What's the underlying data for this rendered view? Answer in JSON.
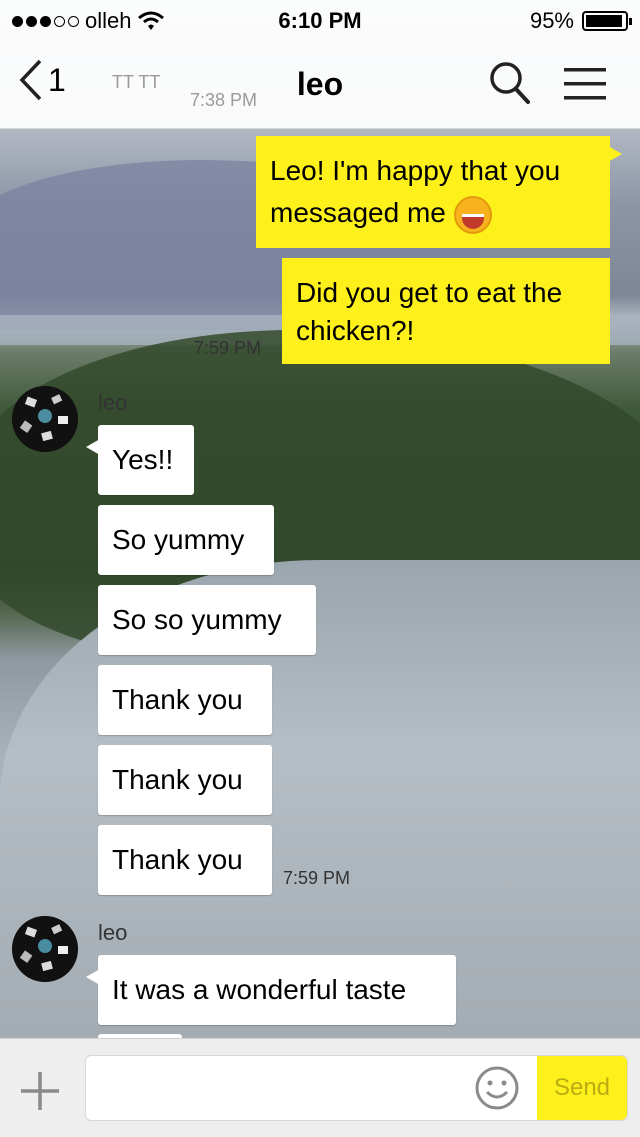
{
  "status": {
    "carrier": "olleh",
    "time": "6:10 PM",
    "battery": "95%",
    "battery_level": 0.95
  },
  "nav": {
    "back_count": "1",
    "title": "leo",
    "ghost_time": "7:38 PM",
    "ghost_text": "TT TT"
  },
  "messages": {
    "m1a": "Leo! I'm happy that you",
    "m1b": "messaged me",
    "m2a": "Did you get to eat the",
    "m2b": "chicken?!",
    "t1": "7:59 PM",
    "sender1": "leo",
    "r1": "Yes!!",
    "r2": "So yummy",
    "r3": "So so yummy",
    "r4": "Thank you",
    "r5": "Thank you",
    "r6": "Thank you",
    "t2": "7:59 PM",
    "sender2": "leo",
    "r7": "It was a wonderful taste"
  },
  "input": {
    "placeholder": "",
    "send_label": "Send"
  },
  "colors": {
    "accent": "#fef01b",
    "send_text": "#b9ad13"
  }
}
